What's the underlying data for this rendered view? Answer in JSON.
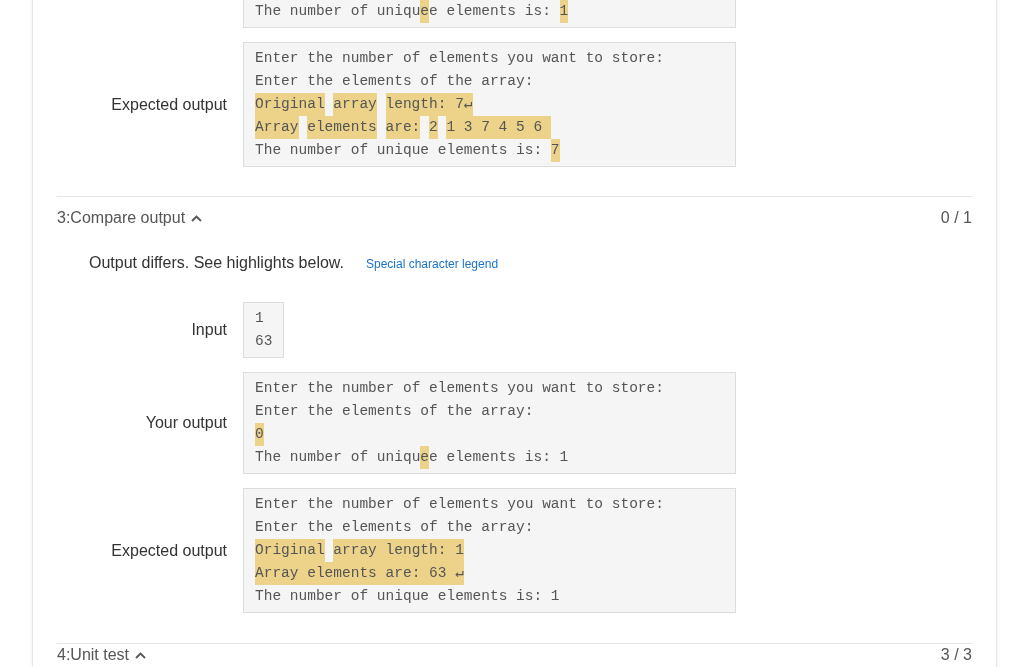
{
  "sections": [
    {
      "rows": [
        {
          "kind": "output",
          "lines": [
            [
              {
                "text": "The number of uniqu",
                "diff": false
              },
              {
                "text": "e",
                "diff": true
              },
              {
                "text": "e elements is: ",
                "diff": false
              },
              {
                "text": "1",
                "diff": true
              }
            ]
          ]
        },
        {
          "kind": "output",
          "label": "Expected output",
          "lines": [
            [
              {
                "text": "Enter the number of elements you want to store:",
                "diff": false
              }
            ],
            [
              {
                "text": "Enter the elements of the array:",
                "diff": false
              }
            ],
            [
              {
                "text": "Original",
                "diff": true
              },
              {
                "text": "array",
                "diff": true,
                "gap_before": true
              },
              {
                "text": "length: 7↵",
                "diff": true,
                "gap_before": true
              }
            ],
            [
              {
                "text": "Array",
                "diff": true
              },
              {
                "text": "elements",
                "diff": true,
                "gap_before": true
              },
              {
                "text": "are:",
                "diff": true,
                "gap_before": true
              },
              {
                "text": "2",
                "diff": true,
                "gap_before": true
              },
              {
                "text": "1 3 7 4 5 6 ",
                "diff": true,
                "gap_before": true
              }
            ],
            [
              {
                "text": "The number of unique elements is: ",
                "diff": false
              },
              {
                "text": "7",
                "diff": true
              }
            ]
          ]
        }
      ]
    },
    {
      "title": "3:Compare output",
      "expanded": true,
      "score": "0 / 1",
      "message": "Output differs. See highlights below.",
      "link": "Special character legend",
      "rows": [
        {
          "kind": "input",
          "label": "Input",
          "lines": [
            [
              {
                "text": "1",
                "diff": false
              }
            ],
            [
              {
                "text": "63",
                "diff": false
              }
            ]
          ]
        },
        {
          "kind": "output",
          "label": "Your output",
          "lines": [
            [
              {
                "text": "Enter the number of elements you want to store:",
                "diff": false
              }
            ],
            [
              {
                "text": "Enter the elements of the array:",
                "diff": false
              }
            ],
            [
              {
                "text": "0",
                "diff": true
              }
            ],
            [
              {
                "text": "The number of uniqu",
                "diff": false
              },
              {
                "text": "e",
                "diff": true
              },
              {
                "text": "e elements is: 1",
                "diff": false
              }
            ]
          ]
        },
        {
          "kind": "output",
          "label": "Expected output",
          "lines": [
            [
              {
                "text": "Enter the number of elements you want to store:",
                "diff": false
              }
            ],
            [
              {
                "text": "Enter the elements of the array:",
                "diff": false
              }
            ],
            [
              {
                "text": "Original",
                "diff": true
              },
              {
                "text": "array length: 1",
                "diff": true,
                "gap_before": true
              }
            ],
            [
              {
                "text": "Array elements are: 63 ↵",
                "diff": true
              }
            ],
            [
              {
                "text": "The number of unique elements is: 1",
                "diff": false
              }
            ]
          ]
        }
      ]
    },
    {
      "title": "4:Unit test",
      "expanded": true,
      "score": "3 / 3"
    }
  ]
}
